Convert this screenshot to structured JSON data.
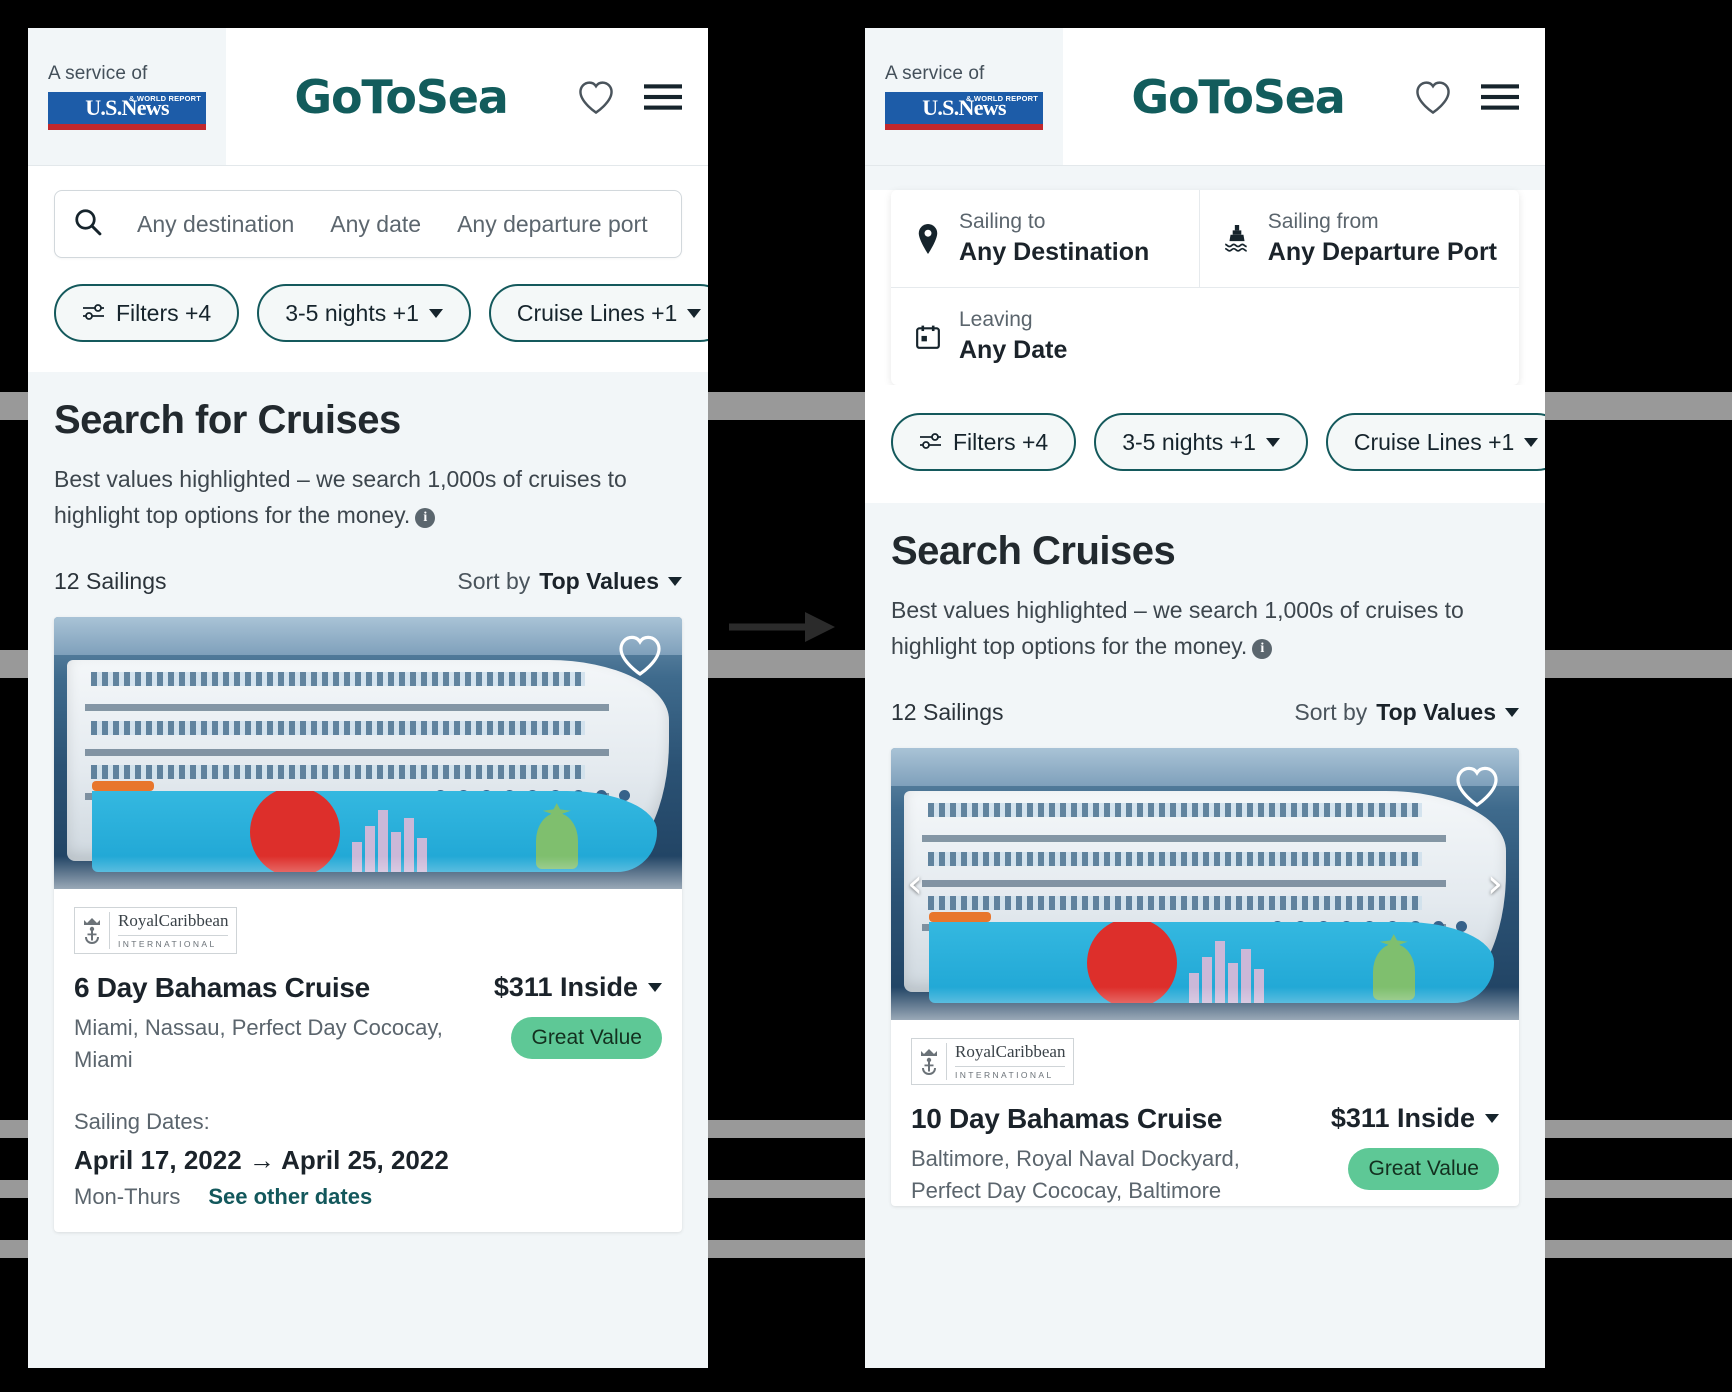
{
  "brand": {
    "service_of": "A service of",
    "publisher_main": "U.S.News",
    "publisher_sub": "& WORLD REPORT",
    "logo": "GoToSea",
    "accent_color": "#125c5c",
    "badge_color": "#5ec896"
  },
  "left": {
    "search": {
      "destination_placeholder": "Any destination",
      "date_placeholder": "Any date",
      "port_placeholder": "Any departure port"
    },
    "pills": [
      {
        "label": "Filters +4",
        "has_caret": false
      },
      {
        "label": "3-5 nights +1",
        "has_caret": true
      },
      {
        "label": "Cruise Lines +1",
        "has_caret": true
      }
    ],
    "page_title": "Search for Cruises",
    "page_subtitle": "Best values highlighted – we search 1,000s of cruises to highlight top options for the money.",
    "info_glyph": "i",
    "sailings_count": "12 Sailings",
    "sort_prefix": "Sort by",
    "sort_value": "Top Values",
    "card": {
      "line_name": "RoyalCaribbean",
      "line_sub": "INTERNATIONAL",
      "title": "6 Day Bahamas Cruise",
      "ports": "Miami, Nassau, Perfect Day Cococay, Miami",
      "price": "$311 Inside",
      "badge": "Great Value",
      "dates_label": "Sailing Dates:",
      "dates_value": "April 17, 2022 → April 25, 2022",
      "dates_days": "Mon-Thurs",
      "dates_link": "See other dates"
    }
  },
  "right": {
    "search": {
      "sailing_to_label": "Sailing to",
      "sailing_to_value": "Any Destination",
      "sailing_from_label": "Sailing from",
      "sailing_from_value": "Any Departure Port",
      "leaving_label": "Leaving",
      "leaving_value": "Any Date"
    },
    "pills": [
      {
        "label": "Filters +4",
        "has_caret": false
      },
      {
        "label": "3-5 nights +1",
        "has_caret": true
      },
      {
        "label": "Cruise Lines +1",
        "has_caret": true
      }
    ],
    "page_title": "Search Cruises",
    "page_subtitle": "Best values highlighted – we search 1,000s of cruises to highlight top options for the money.",
    "info_glyph": "i",
    "sailings_count": "12 Sailings",
    "sort_prefix": "Sort by",
    "sort_value": "Top Values",
    "carousel": {
      "prev": "‹",
      "next": "›"
    },
    "card": {
      "line_name": "RoyalCaribbean",
      "line_sub": "INTERNATIONAL",
      "title": "10 Day Bahamas Cruise",
      "ports": "Baltimore, Royal Naval Dockyard, Perfect Day Cococay, Baltimore",
      "price": "$311 Inside",
      "badge": "Great Value"
    }
  }
}
